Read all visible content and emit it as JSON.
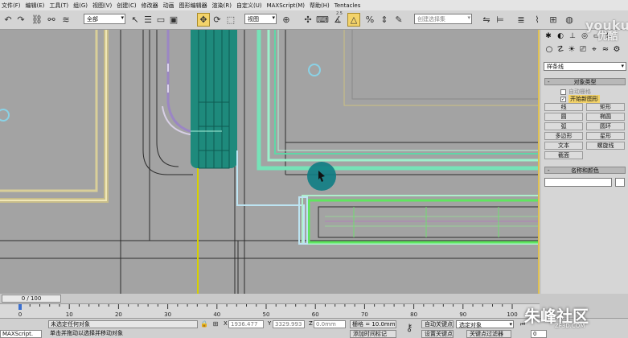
{
  "menu": [
    "文件(F)",
    "编辑(E)",
    "工具(T)",
    "组(G)",
    "视图(V)",
    "创建(C)",
    "修改器",
    "动画",
    "图形编辑器",
    "渲染(R)",
    "自定义(U)",
    "MAXScript(M)",
    "帮助(H)",
    "Tentacles"
  ],
  "toolbar": {
    "selection_filter": "全部",
    "reference_coord": "视图",
    "named_selection_placeholder": "创建选择集",
    "snap_badge": "2.5"
  },
  "command_panel": {
    "category": "样条线",
    "object_type_rollout": "对象类型",
    "auto_grid": "自动栅格",
    "start_new_shape": "开始新图形",
    "object_buttons": [
      "线",
      "矩形",
      "圆",
      "椭圆",
      "弧",
      "圆环",
      "多边形",
      "星形",
      "文本",
      "螺旋线",
      "截面"
    ],
    "name_color_rollout": "名称和颜色"
  },
  "timeline": {
    "frame_display": "0 / 100",
    "ticks": [
      "0",
      "10",
      "20",
      "30",
      "40",
      "50",
      "60",
      "70",
      "80",
      "90",
      "100"
    ]
  },
  "status": {
    "maxscript_label": "MAXScript.",
    "selection_status": "未选定任何对象",
    "prompt": "单击并拖动以选择并移动对象",
    "x_label": "X",
    "x_value": "1936.477",
    "y_label": "Y",
    "y_value": "3329.993",
    "z_label": "Z",
    "z_value": "0.0mm",
    "grid_text": "栅格 = 10.0mm",
    "add_time_tag": "添加时间标记",
    "auto_key": "自动关键点",
    "selected_object": "选定对象",
    "set_key": "设置关键点",
    "key_filters": "关键点过滤器",
    "frame_field": "0"
  },
  "watermarks": {
    "youku_top": "youku",
    "youku_bottom": "优酷",
    "site_name": "朱峰社区",
    "site_url": "ZF3D.COM"
  },
  "colors": {
    "viewport_bg": "#a3a3a3",
    "selection_cyan": "#76e3b8",
    "teal_object": "#1e8a7c",
    "beige_frame": "#e6dca0",
    "accent_yellow": "#f3d36a"
  }
}
